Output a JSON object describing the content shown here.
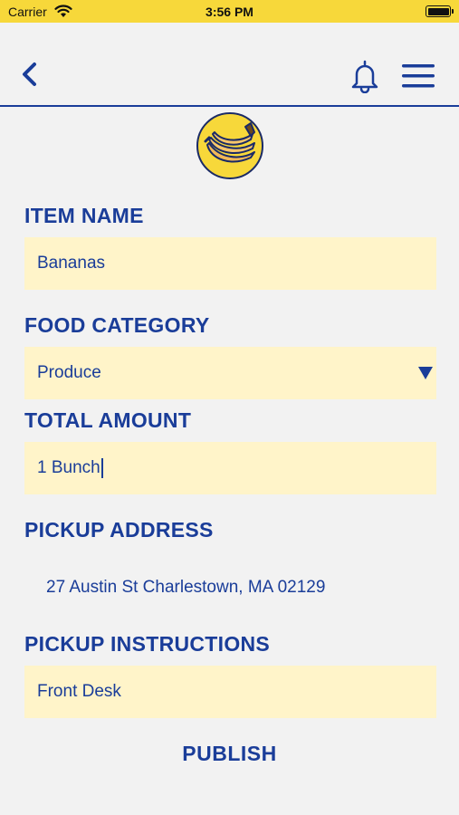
{
  "status_bar": {
    "carrier": "Carrier",
    "time": "3:56 PM"
  },
  "nav": {
    "back_icon": "chevron-left-icon",
    "bell_icon": "bell-icon",
    "menu_icon": "hamburger-menu-icon"
  },
  "logo": {
    "icon": "banana-icon"
  },
  "colors": {
    "accent": "#1a3d99",
    "status_bar_bg": "#f7d83a",
    "field_bg": "#fff4c9",
    "page_bg": "#f2f2f2"
  },
  "form": {
    "item_name": {
      "label": "ITEM NAME",
      "value": "Bananas"
    },
    "food_category": {
      "label": "FOOD CATEGORY",
      "value": "Produce"
    },
    "total_amount": {
      "label": "TOTAL AMOUNT",
      "value": "1 Bunch"
    },
    "pickup_address": {
      "label": "PICKUP ADDRESS",
      "value": "27 Austin St Charlestown, MA 02129"
    },
    "pickup_instructions": {
      "label": "PICKUP INSTRUCTIONS",
      "value": "Front Desk"
    }
  },
  "actions": {
    "publish_label": "PUBLISH"
  }
}
